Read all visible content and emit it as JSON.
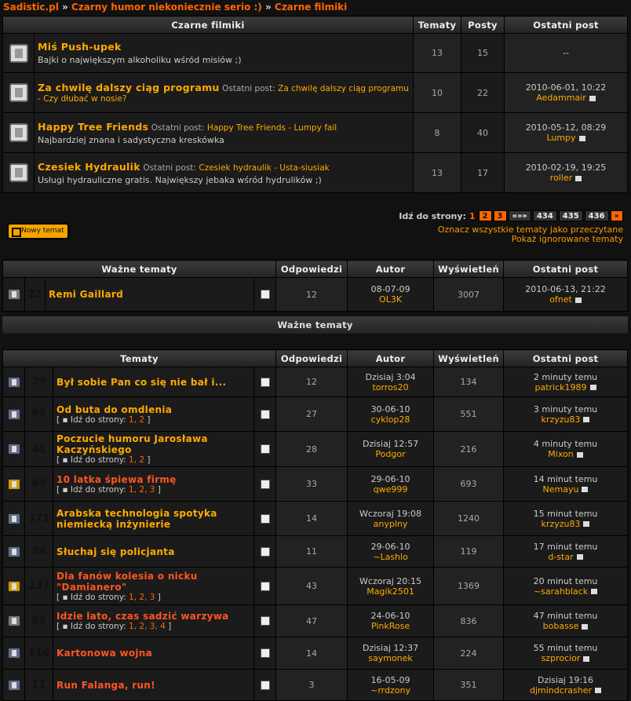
{
  "breadcrumb": {
    "a": "Sadistic.pl",
    "sep1": " » ",
    "b": "Czarny humor niekoniecznie serio :)",
    "sep2": " » ",
    "c": "Czarne filmiki"
  },
  "forum_table": {
    "headers": {
      "title": "Czarne filmiki",
      "topics": "Tematy",
      "posts": "Posty",
      "last": "Ostatni post"
    },
    "rows": [
      {
        "title": "Miś Push-upek",
        "lp_label": "",
        "lp_title": "",
        "desc": "Bajki o największym alkoholiku wśród misiów ;)",
        "topics": "13",
        "posts": "15",
        "last_date": "--",
        "last_user": ""
      },
      {
        "title": "Za chwilę dalszy ciąg programu",
        "lp_label": "Ostatni post:",
        "lp_title": "Za chwilę dalszy ciąg programu - Czy dłubać w nosie?",
        "desc": "",
        "topics": "10",
        "posts": "22",
        "last_date": "2010-06-01, 10:22",
        "last_user": "Aedammair"
      },
      {
        "title": "Happy Tree Friends",
        "lp_label": "Ostatni post:",
        "lp_title": "Happy Tree Friends - Lumpy fail",
        "desc": "Najbardziej znana i sadystyczna kreskówka",
        "topics": "8",
        "posts": "40",
        "last_date": "2010-05-12, 08:29",
        "last_user": "Lumpy"
      },
      {
        "title": "Czesiek Hydraulik",
        "lp_label": "Ostatni post:",
        "lp_title": "Czesiek hydraulik - Usta-siusiak",
        "desc": "Usługi hydrauliczne gratis. Największy jebaka wśród hydrulików ;)",
        "topics": "13",
        "posts": "17",
        "last_date": "2010-02-19, 19:25",
        "last_user": "roller"
      }
    ]
  },
  "new_topic": "Nowy temat",
  "pagination": {
    "label": "Idź do strony:",
    "current": "1",
    "p2": "2",
    "p3": "3",
    "dots": "«»»",
    "p434": "434",
    "p435": "435",
    "p436": "436",
    "next": "»"
  },
  "links": {
    "mark_read": "Oznacz wszystkie tematy jako przeczytane",
    "show_ignored": "Pokaż ignorowane tematy"
  },
  "important": {
    "headers": {
      "title": "Ważne tematy",
      "replies": "Odpowiedzi",
      "author": "Autor",
      "views": "Wyświetleń",
      "last": "Ostatni post"
    },
    "row": {
      "count": "22",
      "title": "Remi Gaillard",
      "replies": "12",
      "date": "08-07-09",
      "author": "OL3K",
      "views": "3007",
      "last_date": "2010-06-13, 21:22",
      "last_user": "ofnet"
    },
    "bar": "Ważne tematy"
  },
  "topics": {
    "headers": {
      "title": "Tematy",
      "replies": "Odpowiedzi",
      "author": "Autor",
      "views": "Wyświetleń",
      "last": "Ostatni post"
    },
    "pages_label": "Idź do strony:",
    "rows": [
      {
        "count": "29",
        "title": "Był sobie Pan co się nie bał i...",
        "pages": "",
        "replies": "12",
        "date": "Dzisiaj 3:04",
        "author": "torros20",
        "views": "134",
        "last_time": "2 minuty temu",
        "last_user": "patrick1989",
        "icon": "normal",
        "red": false
      },
      {
        "count": "95",
        "title": "Od buta do omdlenia",
        "pages": "1, 2",
        "replies": "27",
        "date": "30-06-10",
        "author": "cyklop28",
        "views": "551",
        "last_time": "3 minuty temu",
        "last_user": "krzyzu83",
        "icon": "normal",
        "red": false
      },
      {
        "count": "41",
        "title": "Poczucie humoru Jarosława Kaczyńskiego",
        "pages": "1, 2",
        "replies": "28",
        "date": "Dzisiaj 12:57",
        "author": "Podgor",
        "views": "216",
        "last_time": "4 minuty temu",
        "last_user": "Mixon",
        "icon": "normal",
        "red": false
      },
      {
        "count": "69",
        "title": "10 latka śpiewa firmę",
        "pages": "1, 2, 3",
        "replies": "33",
        "date": "29-06-10",
        "author": "qwe999",
        "views": "693",
        "last_time": "14 minut temu",
        "last_user": "Nemayu",
        "icon": "hot",
        "red": true
      },
      {
        "count": "371",
        "title": "Arabska technologia spotyka niemiecką inżynierie",
        "pages": "",
        "replies": "14",
        "date": "Wczoraj 19:08",
        "author": "anyplny",
        "views": "1240",
        "last_time": "15 minut temu",
        "last_user": "krzyzu83",
        "icon": "normal",
        "red": false
      },
      {
        "count": "24",
        "title": "Słuchaj się policjanta",
        "pages": "",
        "replies": "11",
        "date": "29-06-10",
        "author": "~Lashlo",
        "views": "119",
        "last_time": "17 minut temu",
        "last_user": "d-star",
        "icon": "normal",
        "red": false
      },
      {
        "count": "237",
        "title": "Dla fanów kolesia o nicku \"Damianero\"",
        "pages": "1, 2, 3",
        "replies": "43",
        "date": "Wczoraj 20:15",
        "author": "Magik2501",
        "views": "1369",
        "last_time": "20 minut temu",
        "last_user": "~sarahblack",
        "icon": "hot",
        "red": true
      },
      {
        "count": "65",
        "title": "Idzie lato, czas sadzić warzywa",
        "pages": "1, 2, 3, 4",
        "replies": "47",
        "date": "24-06-10",
        "author": "PinkRose",
        "views": "836",
        "last_time": "47 minut temu",
        "last_user": "bobasse",
        "icon": "lock",
        "red": true
      },
      {
        "count": "116",
        "title": "Kartonowa wojna",
        "pages": "",
        "replies": "14",
        "date": "Dzisiaj 12:37",
        "author": "saymonek",
        "views": "224",
        "last_time": "55 minut temu",
        "last_user": "szprocior",
        "icon": "normal",
        "red": true
      },
      {
        "count": "11",
        "title": "Run Falanga, run!",
        "pages": "",
        "replies": "3",
        "date": "16-05-09",
        "author": "~rrdzony",
        "views": "351",
        "last_time": "Dzisiaj 19:16",
        "last_user": "djmindcrasher",
        "icon": "normal",
        "red": true
      }
    ]
  }
}
